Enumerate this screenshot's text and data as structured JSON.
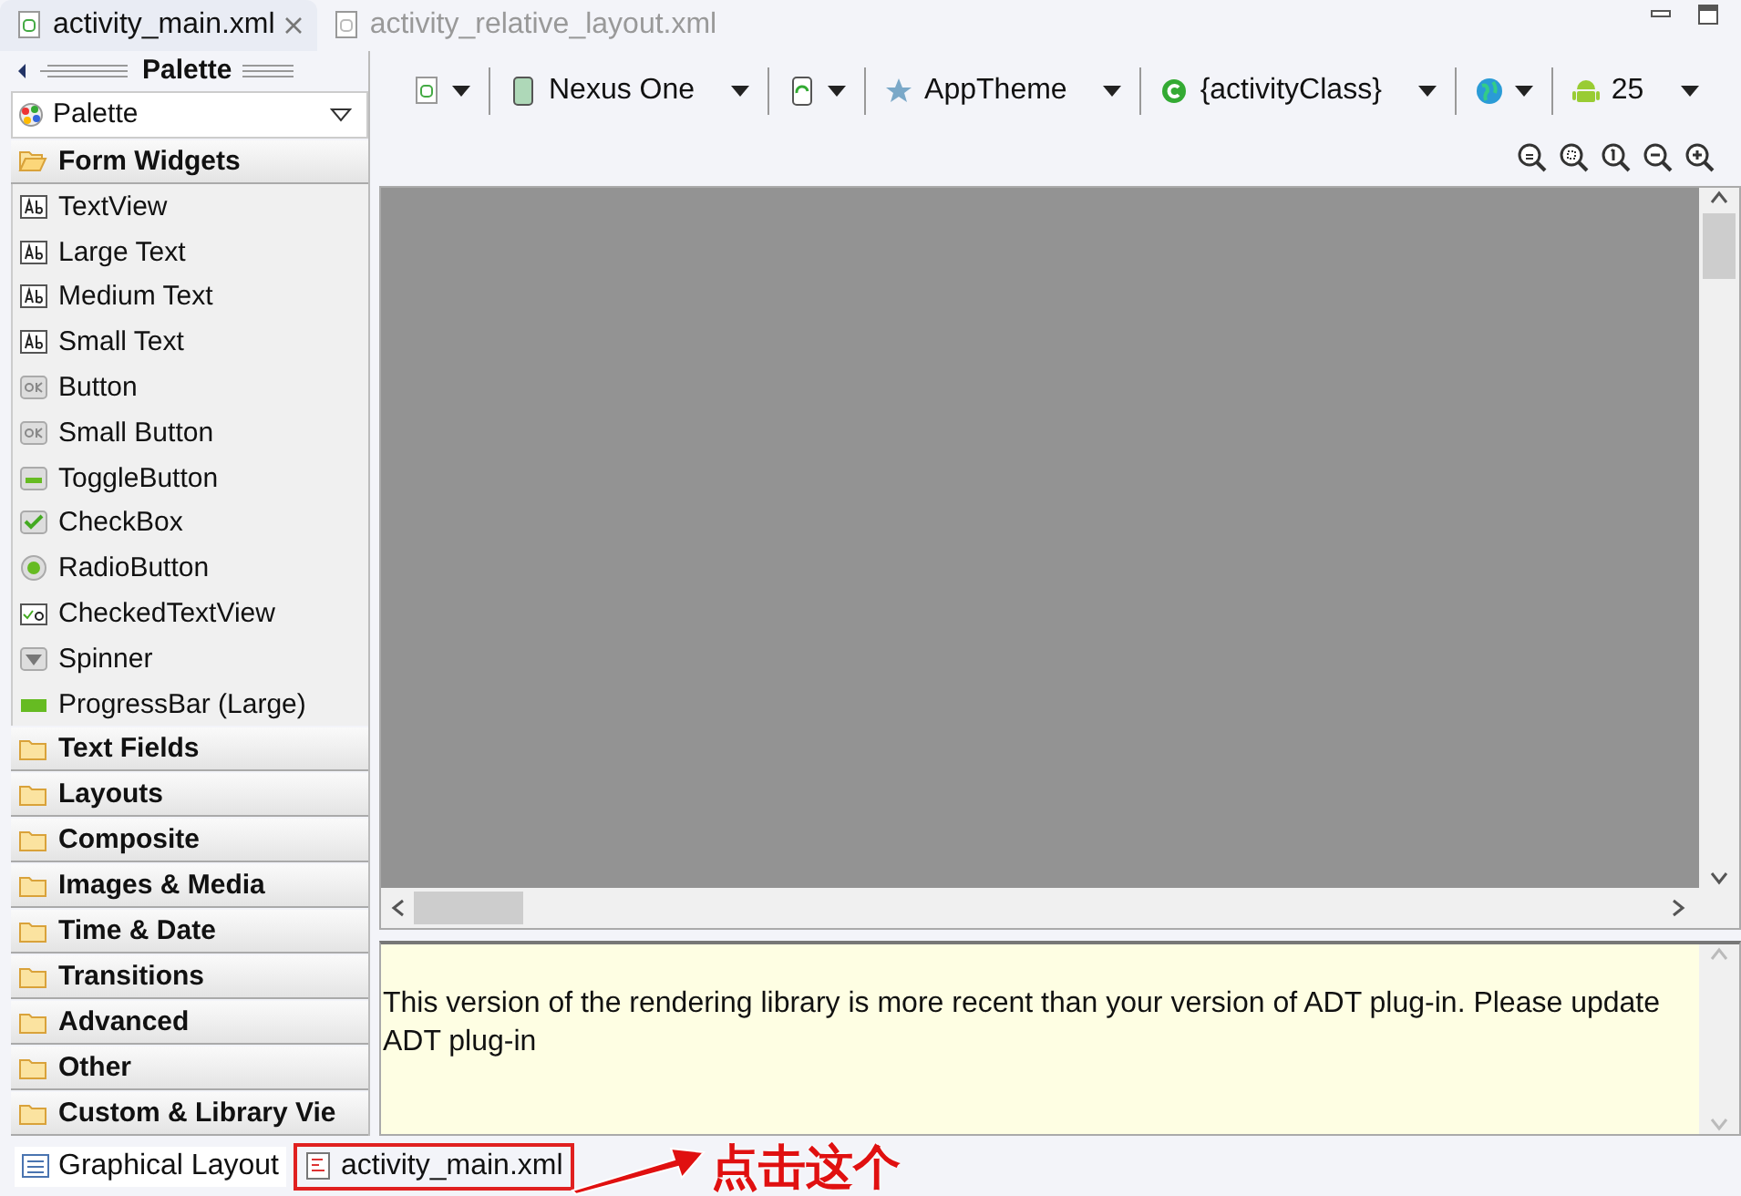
{
  "editor_tabs": [
    {
      "label": "activity_main.xml",
      "selected": true,
      "closable": true
    },
    {
      "label": "activity_relative_layout.xml",
      "selected": false,
      "closable": false
    }
  ],
  "palette": {
    "title": "Palette",
    "dropdown": "Palette",
    "categories": [
      {
        "label": "Form Widgets",
        "expanded": true,
        "items": [
          {
            "label": "TextView",
            "kind": "text"
          },
          {
            "label": "Large Text",
            "kind": "text"
          },
          {
            "label": "Medium Text",
            "kind": "text"
          },
          {
            "label": "Small Text",
            "kind": "text"
          },
          {
            "label": "Button",
            "kind": "button"
          },
          {
            "label": "Small Button",
            "kind": "button"
          },
          {
            "label": "ToggleButton",
            "kind": "toggle"
          },
          {
            "label": "CheckBox",
            "kind": "checkbox"
          },
          {
            "label": "RadioButton",
            "kind": "radio"
          },
          {
            "label": "CheckedTextView",
            "kind": "checkedtext"
          },
          {
            "label": "Spinner",
            "kind": "spinner"
          },
          {
            "label": "ProgressBar (Large)",
            "kind": "progress"
          }
        ]
      },
      {
        "label": "Text Fields",
        "expanded": false
      },
      {
        "label": "Layouts",
        "expanded": false
      },
      {
        "label": "Composite",
        "expanded": false
      },
      {
        "label": "Images & Media",
        "expanded": false
      },
      {
        "label": "Time & Date",
        "expanded": false
      },
      {
        "label": "Transitions",
        "expanded": false
      },
      {
        "label": "Advanced",
        "expanded": false
      },
      {
        "label": "Other",
        "expanded": false
      },
      {
        "label": "Custom & Library Vie",
        "expanded": false
      }
    ]
  },
  "toolbar": [
    {
      "kind": "file"
    },
    {
      "kind": "device",
      "label": "Nexus One"
    },
    {
      "kind": "rotate"
    },
    {
      "kind": "theme",
      "label": "AppTheme"
    },
    {
      "kind": "activity",
      "label": "{activityClass}"
    },
    {
      "kind": "locale"
    },
    {
      "kind": "android",
      "label": "25"
    }
  ],
  "message": "This version of the rendering library is more recent than your version of ADT plug-in. Please update ADT plug-in",
  "bottom_tabs": [
    {
      "label": "Graphical Layout",
      "selected": true,
      "kind": "layout"
    },
    {
      "label": "activity_main.xml",
      "selected": false,
      "kind": "xml"
    }
  ],
  "annotation": {
    "text": "点击这个"
  }
}
